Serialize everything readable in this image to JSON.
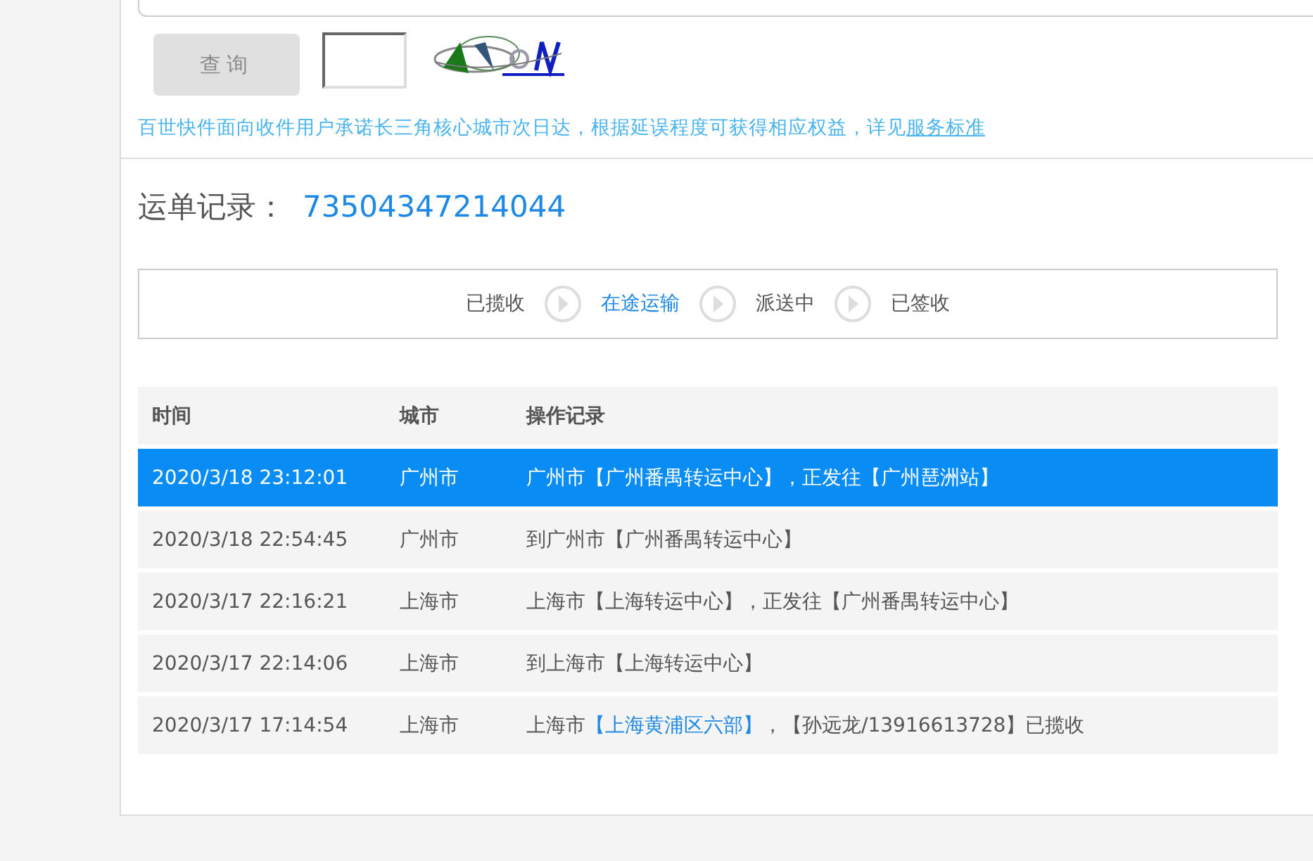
{
  "query_form": {
    "button": {
      "label": "查询",
      "disabled": true
    },
    "notice": "百世快件面向收件用户承诺长三角核心城市次日达，根据延误程度可获得相应权益，详见",
    "notice_link": "服务标准"
  },
  "record": {
    "label": "运单记录：",
    "number": "73504347214044"
  },
  "steps": [
    {
      "label": "已揽收",
      "selected": false
    },
    {
      "label": "在途运输",
      "selected": true
    },
    {
      "label": "派送中",
      "selected": false
    },
    {
      "label": "已签收",
      "selected": false
    }
  ],
  "table": {
    "columns": [
      "时间",
      "城市",
      "操作记录"
    ],
    "rows": [
      {
        "time": "2020/3/18 23:12:01",
        "city": "广州市",
        "operation": [
          {
            "text": "广州市【广州番禺转运中心】，正发往【广州琶洲站】"
          }
        ],
        "selected": true
      },
      {
        "time": "2020/3/18 22:54:45",
        "city": "广州市",
        "operation": [
          {
            "text": "到广州市【广州番禺转运中心】"
          }
        ],
        "selected": false
      },
      {
        "time": "2020/3/17 22:16:21",
        "city": "上海市",
        "operation": [
          {
            "text": "上海市【上海转运中心】，正发往【广州番禺转运中心】"
          }
        ],
        "selected": false
      },
      {
        "time": "2020/3/17 22:14:06",
        "city": "上海市",
        "operation": [
          {
            "text": "到上海市【上海转运中心】"
          }
        ],
        "selected": false
      },
      {
        "time": "2020/3/17 17:14:54",
        "city": "上海市",
        "operation": [
          {
            "text": "上海市"
          },
          {
            "text": "【上海黄浦区六部】",
            "kind": "link"
          },
          {
            "text": "，【孙远龙/13916613728】已揽收"
          }
        ],
        "selected": false
      }
    ]
  }
}
